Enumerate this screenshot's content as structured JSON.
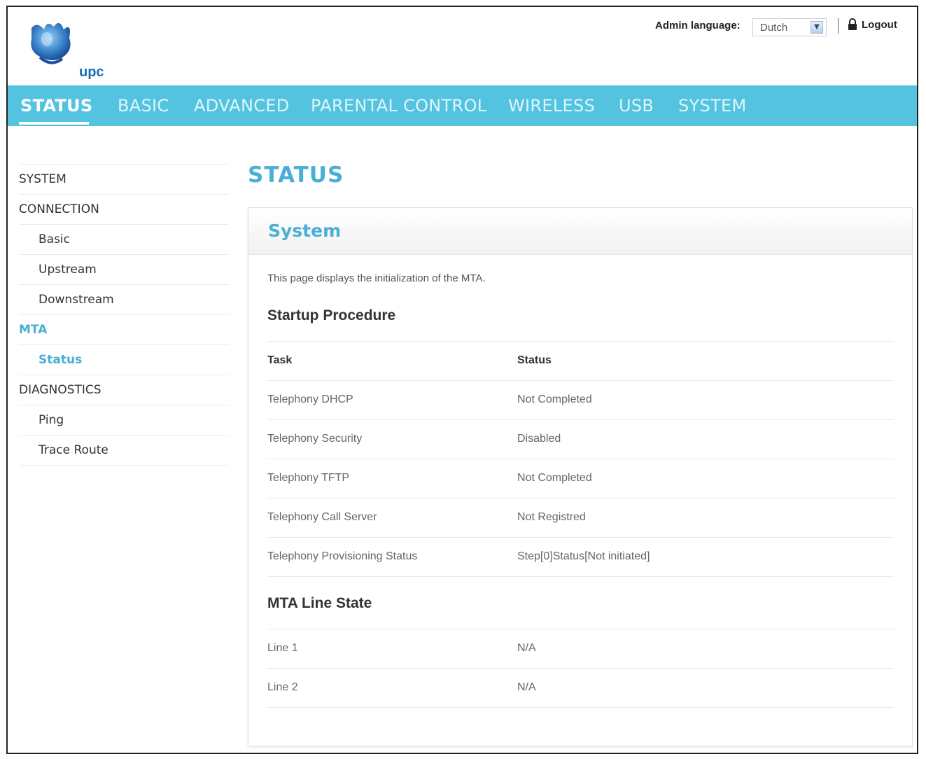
{
  "header": {
    "logo_text": "upc",
    "admin_language_label": "Admin language:",
    "language_selected": "Dutch",
    "logout_label": "Logout"
  },
  "nav": {
    "tabs": [
      {
        "label": "STATUS",
        "active": true
      },
      {
        "label": "BASIC",
        "active": false
      },
      {
        "label": "ADVANCED",
        "active": false
      },
      {
        "label": "PARENTAL CONTROL",
        "active": false
      },
      {
        "label": "WIRELESS",
        "active": false
      },
      {
        "label": "USB",
        "active": false
      },
      {
        "label": "SYSTEM",
        "active": false
      }
    ]
  },
  "sidebar": {
    "items": [
      {
        "label": "SYSTEM",
        "level": "section"
      },
      {
        "label": "CONNECTION",
        "level": "section"
      },
      {
        "label": "Basic",
        "level": "sub"
      },
      {
        "label": "Upstream",
        "level": "sub"
      },
      {
        "label": "Downstream",
        "level": "sub"
      },
      {
        "label": "MTA",
        "level": "section",
        "highlight": true
      },
      {
        "label": "Status",
        "level": "sub",
        "highlight": true
      },
      {
        "label": "DIAGNOSTICS",
        "level": "section"
      },
      {
        "label": "Ping",
        "level": "sub"
      },
      {
        "label": "Trace Route",
        "level": "sub"
      }
    ]
  },
  "main": {
    "page_title": "STATUS",
    "panel_title": "System",
    "description": "This page displays the initialization of the MTA.",
    "startup": {
      "title": "Startup Procedure",
      "headers": [
        "Task",
        "Status"
      ],
      "rows": [
        [
          "Telephony DHCP",
          "Not Completed"
        ],
        [
          "Telephony Security",
          "Disabled"
        ],
        [
          "Telephony TFTP",
          "Not Completed"
        ],
        [
          "Telephony Call Server",
          "Not Registred"
        ],
        [
          "Telephony Provisioning Status",
          "Step[0]Status[Not initiated]"
        ]
      ]
    },
    "line_state": {
      "title": "MTA Line State",
      "rows": [
        [
          "Line 1",
          "N/A"
        ],
        [
          "Line 2",
          "N/A"
        ]
      ]
    }
  },
  "colors": {
    "accent": "#4aaed6",
    "nav_bar": "#53c3e0"
  }
}
